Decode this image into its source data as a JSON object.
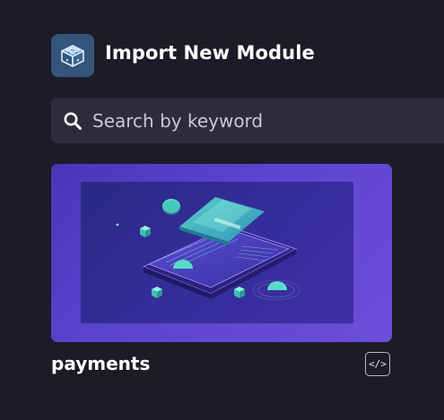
{
  "header": {
    "icon": "module-blocks-icon",
    "title": "Import New Module"
  },
  "search": {
    "icon": "search-icon",
    "placeholder": "Search by keyword",
    "value": ""
  },
  "modules": [
    {
      "name": "payments",
      "thumbnail": "payments-illustration",
      "action_icon": "code-icon",
      "action_glyph": "</>"
    }
  ],
  "colors": {
    "background": "#1c1c28",
    "search_background": "#2c2c3b",
    "icon_tile": "#35557a",
    "card_gradient_start": "#4a36b8",
    "card_gradient_end": "#6a4fd8",
    "accent_teal": "#4fd6c2"
  }
}
